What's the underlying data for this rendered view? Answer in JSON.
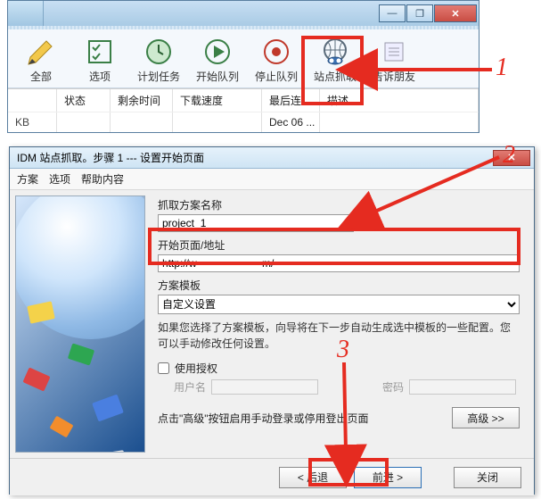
{
  "main": {
    "toolbar": {
      "all": "全部",
      "options": "选项",
      "schedule": "计划任务",
      "start_queue": "开始队列",
      "stop_queue": "停止队列",
      "site_grab": "站点抓取",
      "tell_friend": "告诉朋友"
    },
    "columns": {
      "status": "状态",
      "time_left": "剩余时间",
      "speed": "下载速度",
      "last_conn": "最后连...",
      "desc": "描述"
    },
    "row": {
      "size_unit": "KB",
      "date": "Dec 06 ..."
    }
  },
  "wizard": {
    "title": "IDM 站点抓取。步骤 1 --- 设置开始页面",
    "menu": {
      "scheme": "方案",
      "options": "选项",
      "help": "帮助内容"
    },
    "scheme_name_label": "抓取方案名称",
    "scheme_name_value": "project_1",
    "url_label": "开始页面/地址",
    "url_value": "http://w                      m/",
    "template_label": "方案模板",
    "template_value": "自定义设置",
    "hint": "如果您选择了方案模板，向导将在下一步自动生成选中模板的一些配置。您可以手动修改任何设置。",
    "use_auth": "使用授权",
    "user_label": "用户名",
    "pass_label": "密码",
    "adv_hint": "点击\"高级\"按钮启用手动登录或停用登出页面",
    "adv_btn": "高级 >>",
    "back": "< 后退",
    "next": "前进 >",
    "close": "关闭"
  },
  "anno": {
    "n1": "1",
    "n2": "2",
    "n3": "3"
  }
}
